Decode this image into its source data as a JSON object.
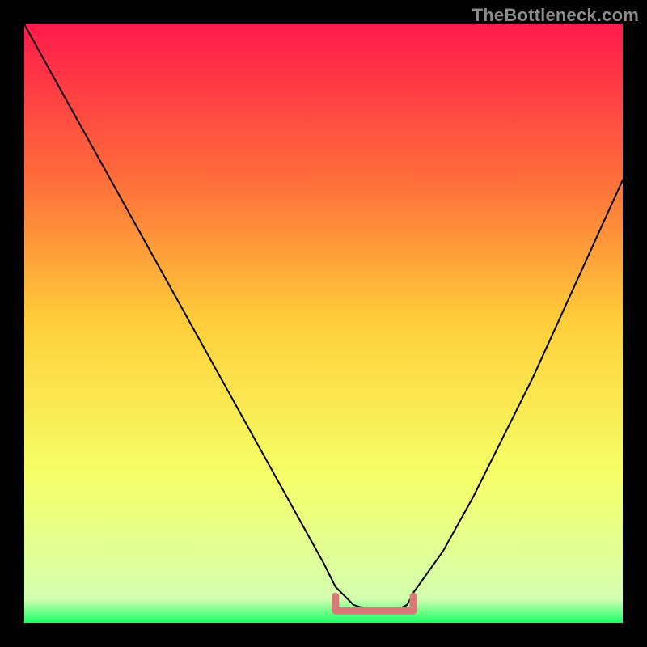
{
  "watermark": "TheBottleneck.com",
  "accent": {
    "marker_color": "#d87a7a",
    "axis_black": "#000000"
  },
  "chart_data": {
    "type": "line",
    "title": "",
    "xlabel": "",
    "ylabel": "",
    "xlim": [
      0,
      100
    ],
    "ylim": [
      0,
      100
    ],
    "grid": false,
    "series": [
      {
        "name": "bottleneck-curve",
        "x": [
          0,
          5,
          10,
          15,
          20,
          25,
          30,
          35,
          40,
          45,
          50,
          52,
          55,
          58,
          60,
          62,
          64,
          65,
          70,
          75,
          80,
          85,
          90,
          95,
          100
        ],
        "y": [
          100,
          91,
          82,
          73,
          64,
          55,
          46,
          37,
          28,
          19,
          10,
          6,
          3,
          2,
          2,
          2,
          3,
          5,
          12,
          21,
          31,
          41,
          52,
          63,
          74
        ]
      }
    ],
    "annotations": [
      {
        "name": "optimal-range-marker",
        "x_start": 52,
        "x_end": 65,
        "y": 2,
        "color": "#d87a7a"
      }
    ],
    "gradient_stops": [
      {
        "offset": 0.0,
        "color": "#ff1a4b"
      },
      {
        "offset": 0.25,
        "color": "#ff6a3a"
      },
      {
        "offset": 0.5,
        "color": "#ffcf3a"
      },
      {
        "offset": 0.75,
        "color": "#f6ff66"
      },
      {
        "offset": 0.96,
        "color": "#d4ffb0"
      },
      {
        "offset": 1.0,
        "color": "#1aff66"
      }
    ]
  }
}
